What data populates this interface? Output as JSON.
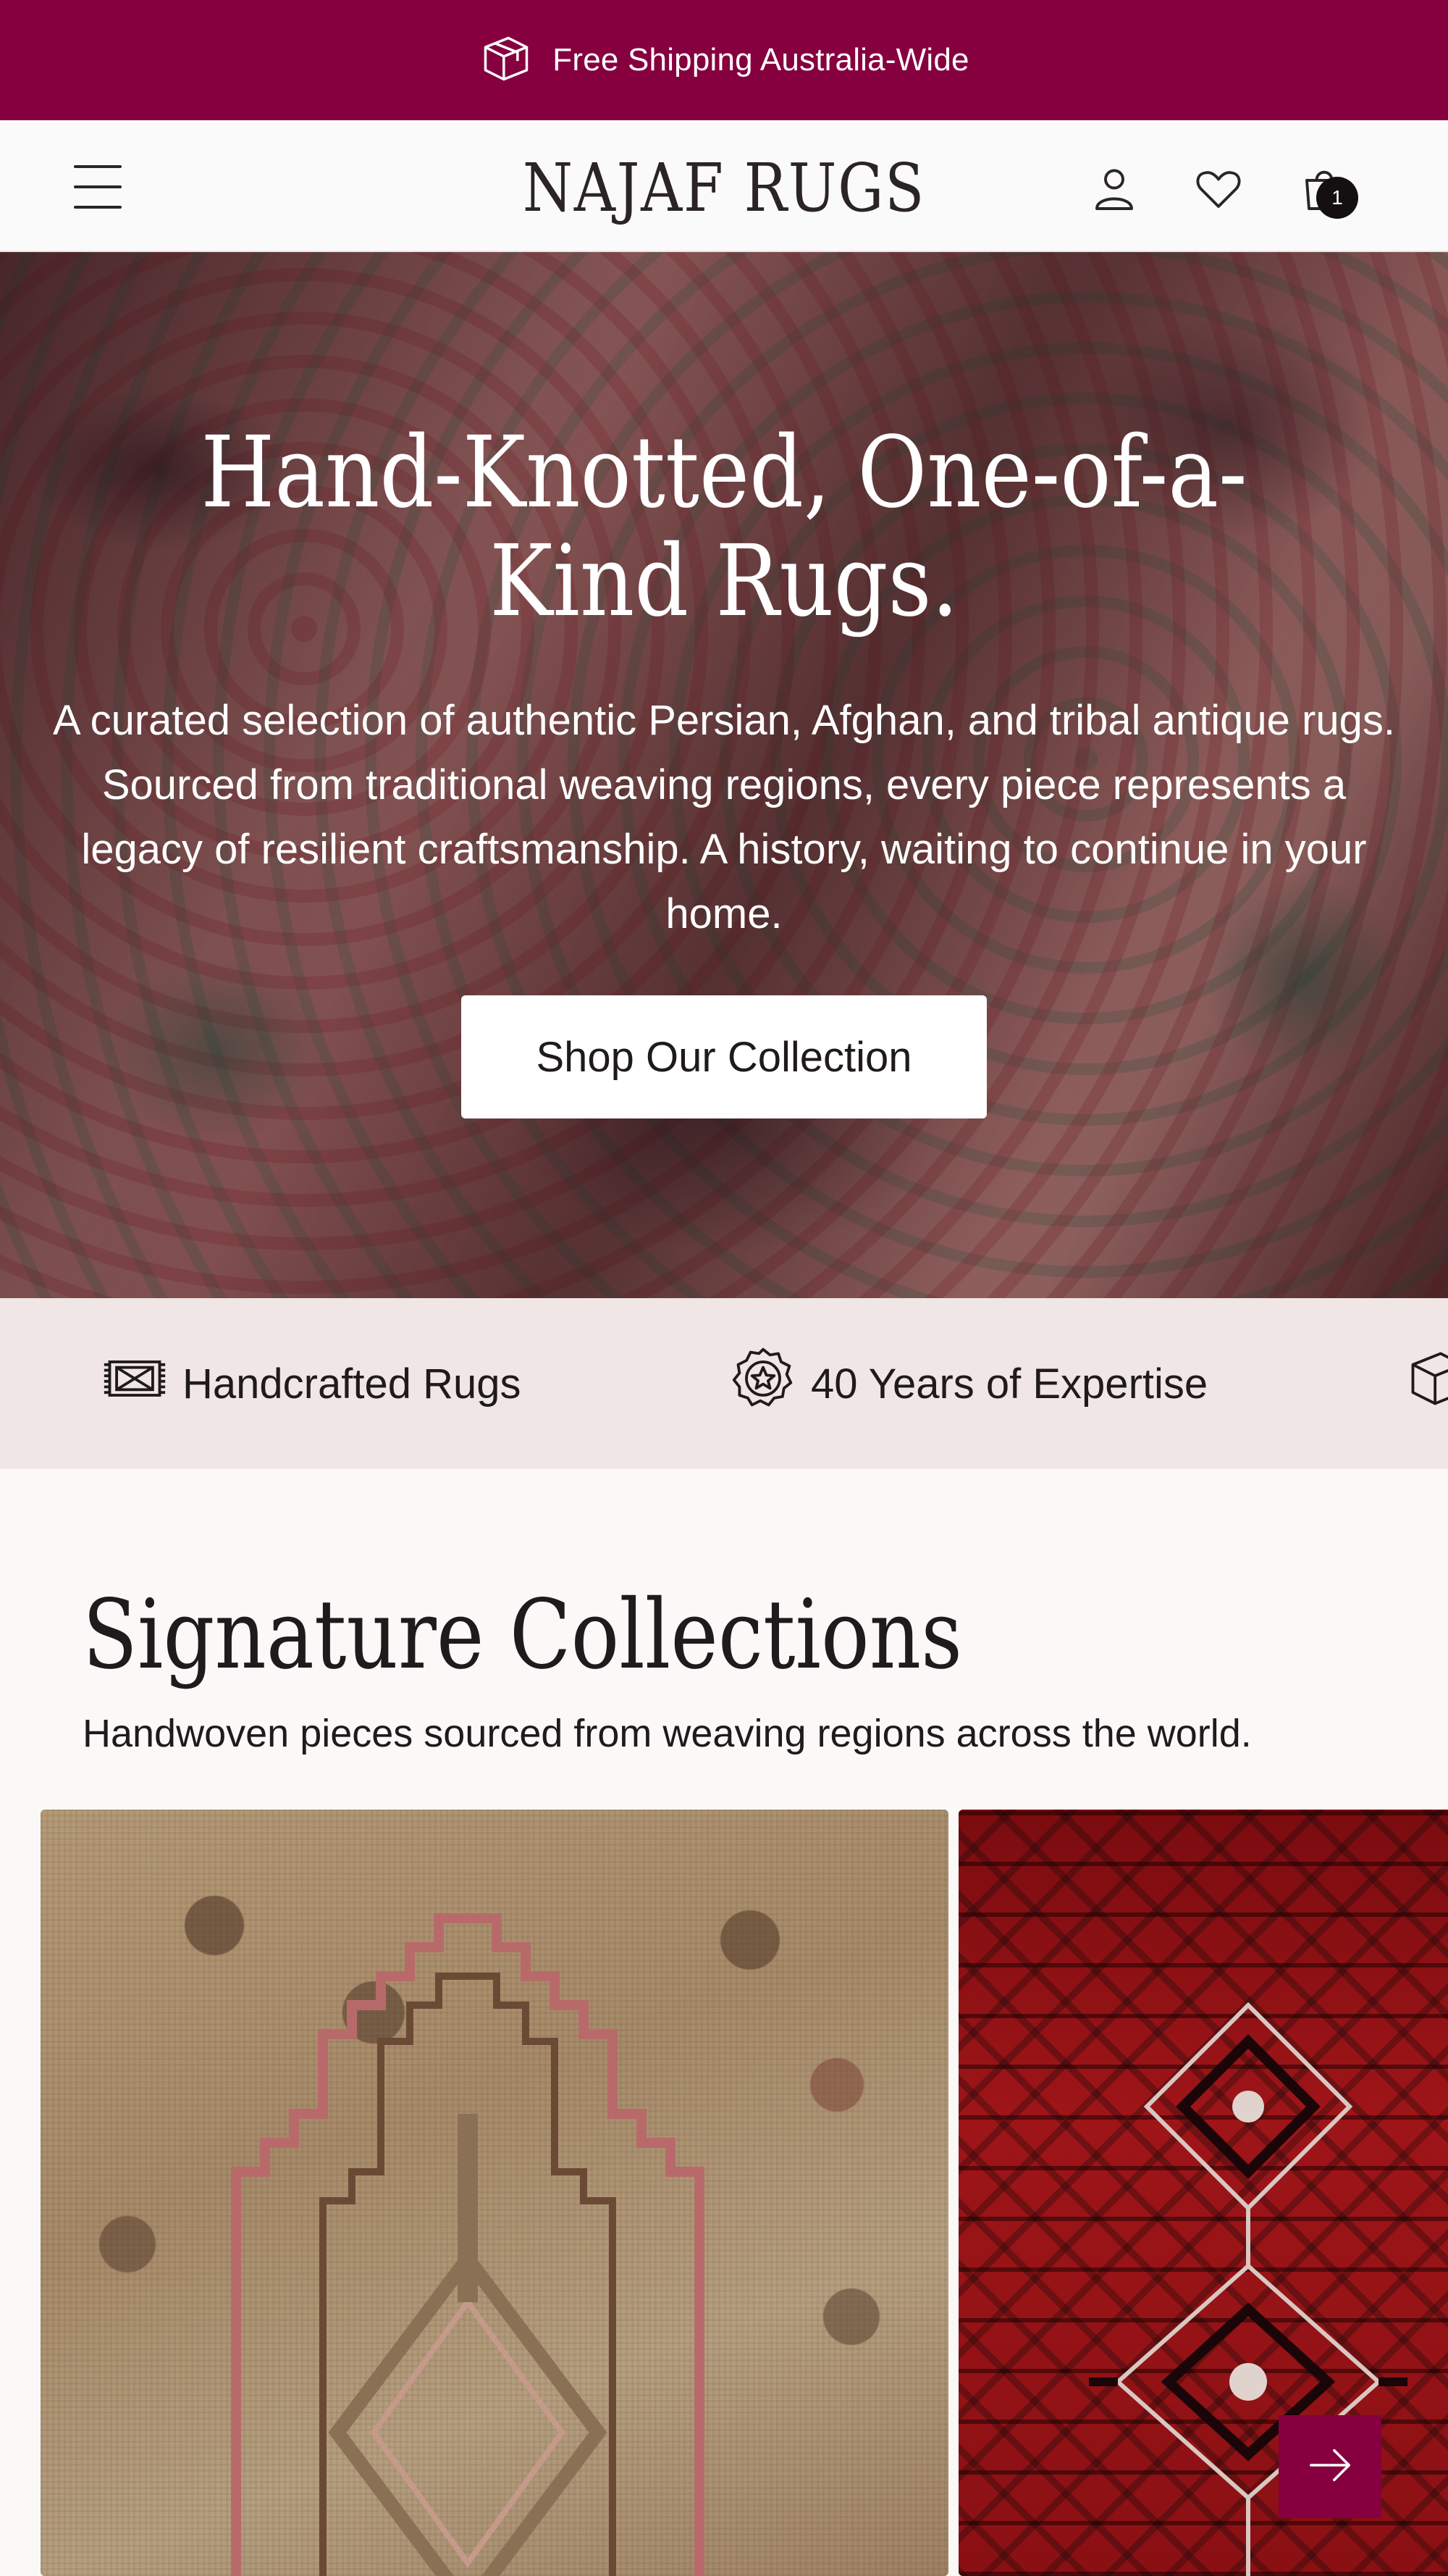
{
  "announcement": {
    "text": "Free Shipping Australia-Wide",
    "icon": "box-icon"
  },
  "header": {
    "logo": "NAJAF RUGS",
    "menu_icon": "hamburger-menu-icon",
    "account_icon": "user-icon",
    "wishlist_icon": "heart-icon",
    "cart_icon": "shopping-bag-icon",
    "cart_count": "1"
  },
  "hero": {
    "title": "Hand-Knotted, One-of-a-Kind Rugs.",
    "description": "A curated selection of authentic Persian, Afghan, and tribal antique rugs. Sourced from traditional weaving regions, every piece represents a legacy of resilient craftsmanship. A history, waiting to continue in your home.",
    "cta_label": "Shop Our Collection"
  },
  "features": [
    {
      "label": "Handcrafted Rugs",
      "icon": "rug-icon"
    },
    {
      "label": "40 Years of Expertise",
      "icon": "badge-star-icon"
    },
    {
      "label": "",
      "icon": "box-icon"
    }
  ],
  "collections": {
    "title": "Signature Collections",
    "subtitle": "Handwoven pieces sourced from weaving regions across the world.",
    "next_icon": "arrow-right-icon"
  },
  "colors": {
    "brand": "#86003f",
    "strip_bg": "#f1e6e6",
    "page_bg": "#fbf9f8"
  }
}
